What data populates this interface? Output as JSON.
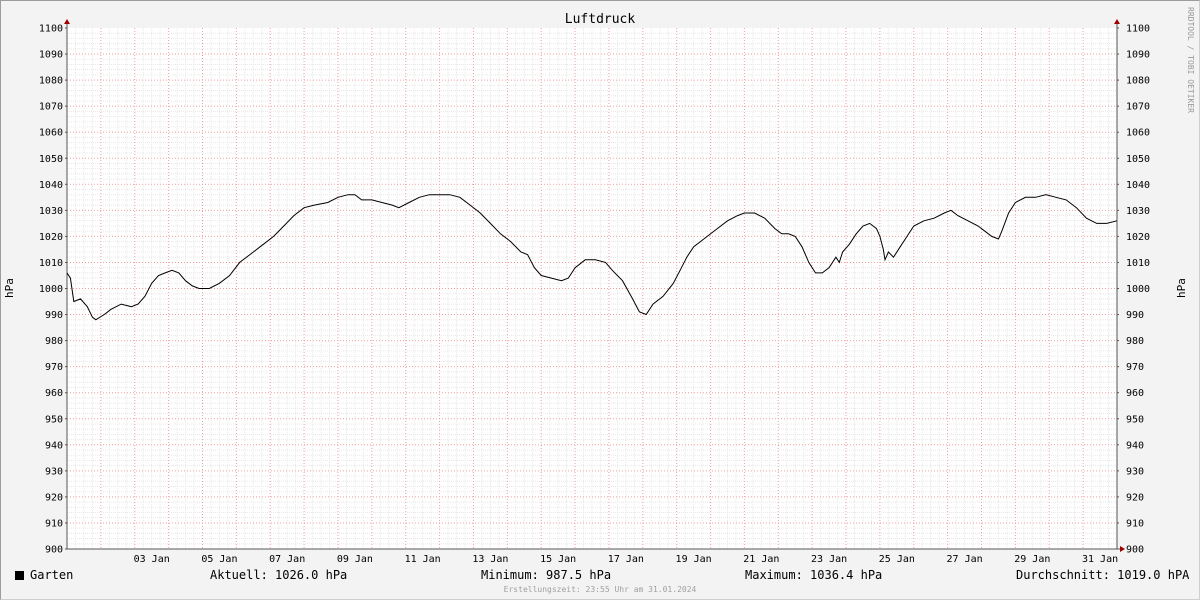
{
  "chart_data": {
    "type": "line",
    "title": "Luftdruck",
    "ylabel": "hPa",
    "ylim": [
      900,
      1100
    ],
    "y_ticks": [
      "900",
      "910",
      "920",
      "930",
      "940",
      "950",
      "960",
      "970",
      "980",
      "990",
      "1000",
      "1010",
      "1020",
      "1030",
      "1040",
      "1050",
      "1060",
      "1070",
      "1080",
      "1090",
      "1100"
    ],
    "x_range": [
      1.0,
      32.0
    ],
    "x_unit": "day of January 2024",
    "x_ticks": [
      {
        "day": 3,
        "label": "03 Jan"
      },
      {
        "day": 5,
        "label": "05 Jan"
      },
      {
        "day": 7,
        "label": "07 Jan"
      },
      {
        "day": 9,
        "label": "09 Jan"
      },
      {
        "day": 11,
        "label": "11 Jan"
      },
      {
        "day": 13,
        "label": "13 Jan"
      },
      {
        "day": 15,
        "label": "15 Jan"
      },
      {
        "day": 17,
        "label": "17 Jan"
      },
      {
        "day": 19,
        "label": "19 Jan"
      },
      {
        "day": 21,
        "label": "21 Jan"
      },
      {
        "day": 23,
        "label": "23 Jan"
      },
      {
        "day": 25,
        "label": "25 Jan"
      },
      {
        "day": 27,
        "label": "27 Jan"
      },
      {
        "day": 29,
        "label": "29 Jan"
      },
      {
        "day": 31,
        "label": "31 Jan"
      }
    ],
    "grid": true,
    "series": [
      {
        "name": "Garten",
        "color": "#000000",
        "points": [
          [
            1.0,
            1006
          ],
          [
            1.1,
            1004
          ],
          [
            1.2,
            995
          ],
          [
            1.4,
            996
          ],
          [
            1.6,
            993
          ],
          [
            1.75,
            989
          ],
          [
            1.85,
            988
          ],
          [
            2.1,
            990
          ],
          [
            2.3,
            992
          ],
          [
            2.6,
            994
          ],
          [
            2.9,
            993
          ],
          [
            3.1,
            994
          ],
          [
            3.3,
            997
          ],
          [
            3.5,
            1002
          ],
          [
            3.7,
            1005
          ],
          [
            3.9,
            1006
          ],
          [
            4.1,
            1007
          ],
          [
            4.3,
            1006
          ],
          [
            4.5,
            1003
          ],
          [
            4.7,
            1001
          ],
          [
            4.9,
            1000
          ],
          [
            5.2,
            1000
          ],
          [
            5.5,
            1002
          ],
          [
            5.8,
            1005
          ],
          [
            6.1,
            1010
          ],
          [
            6.4,
            1013
          ],
          [
            6.8,
            1017
          ],
          [
            7.1,
            1020
          ],
          [
            7.4,
            1024
          ],
          [
            7.7,
            1028
          ],
          [
            8.0,
            1031
          ],
          [
            8.3,
            1032
          ],
          [
            8.7,
            1033
          ],
          [
            9.0,
            1035
          ],
          [
            9.3,
            1036
          ],
          [
            9.5,
            1036
          ],
          [
            9.7,
            1034
          ],
          [
            10.0,
            1034
          ],
          [
            10.3,
            1033
          ],
          [
            10.6,
            1032
          ],
          [
            10.8,
            1031
          ],
          [
            11.1,
            1033
          ],
          [
            11.4,
            1035
          ],
          [
            11.7,
            1036
          ],
          [
            12.0,
            1036
          ],
          [
            12.3,
            1036
          ],
          [
            12.6,
            1035
          ],
          [
            12.9,
            1032
          ],
          [
            13.2,
            1029
          ],
          [
            13.5,
            1025
          ],
          [
            13.8,
            1021
          ],
          [
            14.1,
            1018
          ],
          [
            14.4,
            1014
          ],
          [
            14.6,
            1013
          ],
          [
            14.8,
            1008
          ],
          [
            15.0,
            1005
          ],
          [
            15.3,
            1004
          ],
          [
            15.6,
            1003
          ],
          [
            15.8,
            1004
          ],
          [
            16.0,
            1008
          ],
          [
            16.3,
            1011
          ],
          [
            16.6,
            1011
          ],
          [
            16.9,
            1010
          ],
          [
            17.1,
            1007
          ],
          [
            17.4,
            1003
          ],
          [
            17.7,
            996
          ],
          [
            17.9,
            991
          ],
          [
            18.1,
            990
          ],
          [
            18.3,
            994
          ],
          [
            18.6,
            997
          ],
          [
            18.9,
            1002
          ],
          [
            19.1,
            1007
          ],
          [
            19.3,
            1012
          ],
          [
            19.5,
            1016
          ],
          [
            19.7,
            1018
          ],
          [
            19.9,
            1020
          ],
          [
            20.2,
            1023
          ],
          [
            20.5,
            1026
          ],
          [
            20.8,
            1028
          ],
          [
            21.0,
            1029
          ],
          [
            21.3,
            1029
          ],
          [
            21.6,
            1027
          ],
          [
            21.9,
            1023
          ],
          [
            22.1,
            1021
          ],
          [
            22.3,
            1021
          ],
          [
            22.5,
            1020
          ],
          [
            22.7,
            1016
          ],
          [
            22.9,
            1010
          ],
          [
            23.1,
            1006
          ],
          [
            23.3,
            1006
          ],
          [
            23.5,
            1008
          ],
          [
            23.7,
            1012
          ],
          [
            23.8,
            1010
          ],
          [
            23.9,
            1014
          ],
          [
            24.1,
            1017
          ],
          [
            24.3,
            1021
          ],
          [
            24.5,
            1024
          ],
          [
            24.7,
            1025
          ],
          [
            24.9,
            1023
          ],
          [
            25.0,
            1020
          ],
          [
            25.1,
            1015
          ],
          [
            25.15,
            1011
          ],
          [
            25.25,
            1014
          ],
          [
            25.4,
            1012
          ],
          [
            25.6,
            1016
          ],
          [
            25.8,
            1020
          ],
          [
            26.0,
            1024
          ],
          [
            26.3,
            1026
          ],
          [
            26.6,
            1027
          ],
          [
            26.9,
            1029
          ],
          [
            27.1,
            1030
          ],
          [
            27.3,
            1028
          ],
          [
            27.6,
            1026
          ],
          [
            27.9,
            1024
          ],
          [
            28.1,
            1022
          ],
          [
            28.3,
            1020
          ],
          [
            28.5,
            1019
          ],
          [
            28.6,
            1022
          ],
          [
            28.8,
            1029
          ],
          [
            29.0,
            1033
          ],
          [
            29.3,
            1035
          ],
          [
            29.6,
            1035
          ],
          [
            29.9,
            1036
          ],
          [
            30.2,
            1035
          ],
          [
            30.5,
            1034
          ],
          [
            30.8,
            1031
          ],
          [
            31.1,
            1027
          ],
          [
            31.4,
            1025
          ],
          [
            31.7,
            1025
          ],
          [
            32.0,
            1026
          ]
        ]
      }
    ]
  },
  "side_text": "RRDTOOL / TOBI OETIKER",
  "legend": {
    "series_name": "Garten",
    "aktuell": "Aktuell: 1026.0 hPa",
    "minimum": "Minimum: 987.5 hPa",
    "maximum": "Maximum: 1036.4 hPa",
    "durchschnitt": "Durchschnitt: 1019.0 hPA"
  },
  "footer": {
    "creation_time": "Erstellungszeit: 23:55 Uhr am 31.01.2024"
  }
}
